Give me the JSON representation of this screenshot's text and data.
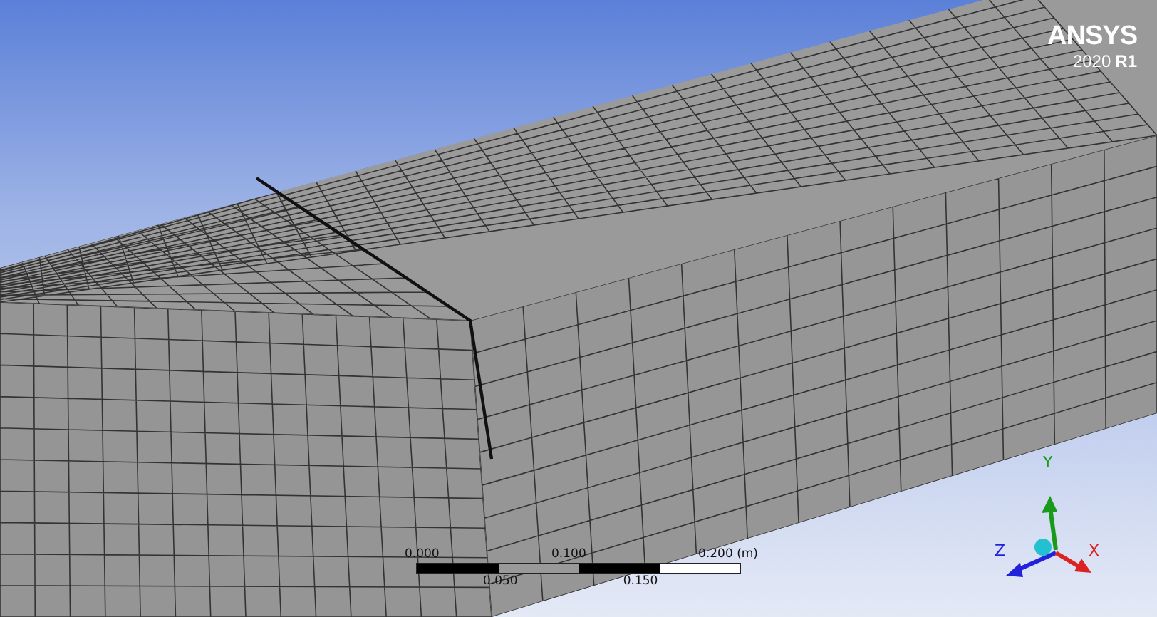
{
  "logo": {
    "brand": "ANSYS",
    "year": "2020",
    "release": "R1"
  },
  "scale_bar": {
    "top_labels": [
      "0.000",
      "0.100",
      "0.200 (m)"
    ],
    "bottom_labels": [
      "0.050",
      "0.150"
    ]
  },
  "triad": {
    "axes": [
      {
        "label": "Y",
        "color": "#1a9a1a"
      },
      {
        "label": "Z",
        "color": "#2222dd"
      },
      {
        "label": "X",
        "color": "#dd2222"
      }
    ]
  }
}
